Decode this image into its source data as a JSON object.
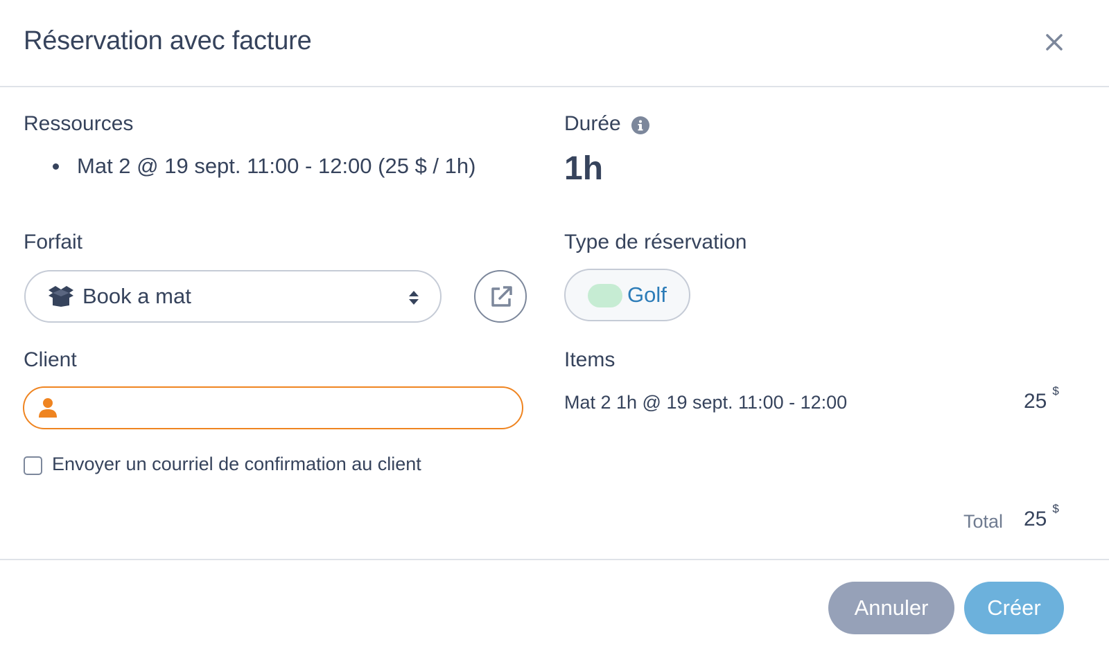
{
  "header": {
    "title": "Réservation avec facture",
    "close_icon": "close-icon"
  },
  "resources": {
    "label": "Ressources",
    "items": [
      "Mat 2 @ 19 sept. 11:00 - 12:00 (25 $ / 1h)"
    ]
  },
  "duration": {
    "label": "Durée",
    "info_icon": "info-icon",
    "value": "1h"
  },
  "package": {
    "label": "Forfait",
    "selected": "Book a mat",
    "icon": "box-open-icon",
    "external_link_icon": "external-link-icon"
  },
  "reservation_type": {
    "label": "Type de réservation",
    "value": "Golf",
    "swatch_color": "#c6ecd3",
    "text_color": "#2c7cb8"
  },
  "client": {
    "label": "Client",
    "value": "",
    "icon": "user-icon",
    "border_color": "#ef8420"
  },
  "confirmation": {
    "label": "Envoyer un courriel de confirmation au client",
    "checked": false
  },
  "items": {
    "label": "Items",
    "rows": [
      {
        "description": "Mat 2 1h @ 19 sept. 11:00 - 12:00",
        "amount": "25",
        "currency": "$"
      }
    ],
    "total_label": "Total",
    "total_amount": "25",
    "total_currency": "$"
  },
  "footer": {
    "cancel_label": "Annuler",
    "create_label": "Créer",
    "cancel_color": "#96a1b8",
    "create_color": "#6cb1dc"
  }
}
